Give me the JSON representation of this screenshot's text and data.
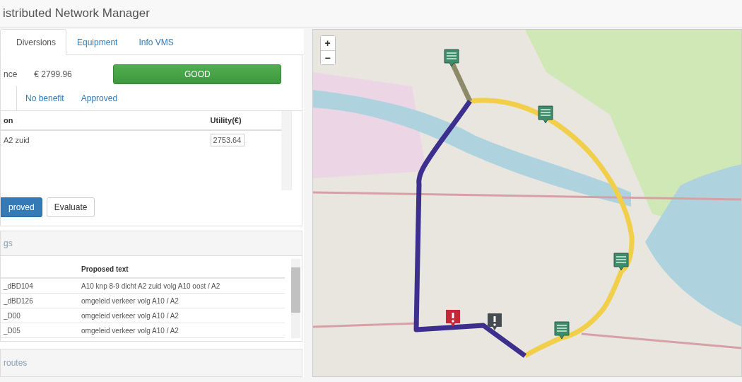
{
  "app_title": "istributed Network Manager",
  "tabs": [
    {
      "label": "Diversions",
      "selected": true
    },
    {
      "label": "Equipment",
      "selected": false
    },
    {
      "label": "Info VMS",
      "selected": false
    }
  ],
  "performance": {
    "label": "nce",
    "value": "€ 2799.96",
    "status": "GOOD"
  },
  "subtabs": [
    {
      "label": "No benefit",
      "selected": false
    },
    {
      "label": "Approved",
      "selected": false
    }
  ],
  "diversions_table": {
    "columns": [
      "on",
      "Utility(€)"
    ],
    "rows": [
      {
        "name": "A2 zuid",
        "utility": "2753.64"
      }
    ]
  },
  "buttons": [
    {
      "label": "proved",
      "kind": "primary"
    },
    {
      "label": "Evaluate",
      "kind": "default"
    }
  ],
  "vms_panel": {
    "title": "gs",
    "column_2": "Proposed text",
    "rows": [
      {
        "id": "_dBD104",
        "text": "A10 knp 8-9 dicht A2 zuid volg A10 oost / A2"
      },
      {
        "id": "_dBD126",
        "text": "omgeleid verkeer volg A10 / A2"
      },
      {
        "id": "_D00",
        "text": "omgeleid verkeer volg A10 / A2"
      },
      {
        "id": "_D05",
        "text": "omgeleid verkeer volg A10 / A2"
      }
    ]
  },
  "routes_panel": {
    "title": "routes"
  },
  "map": {
    "zoom_in": "+",
    "zoom_out": "−",
    "markers": [
      {
        "kind": "vms"
      },
      {
        "kind": "vms"
      },
      {
        "kind": "vms"
      },
      {
        "kind": "vms"
      },
      {
        "kind": "incident",
        "color": "#c42838"
      },
      {
        "kind": "incident",
        "color": "#454d52"
      }
    ]
  }
}
